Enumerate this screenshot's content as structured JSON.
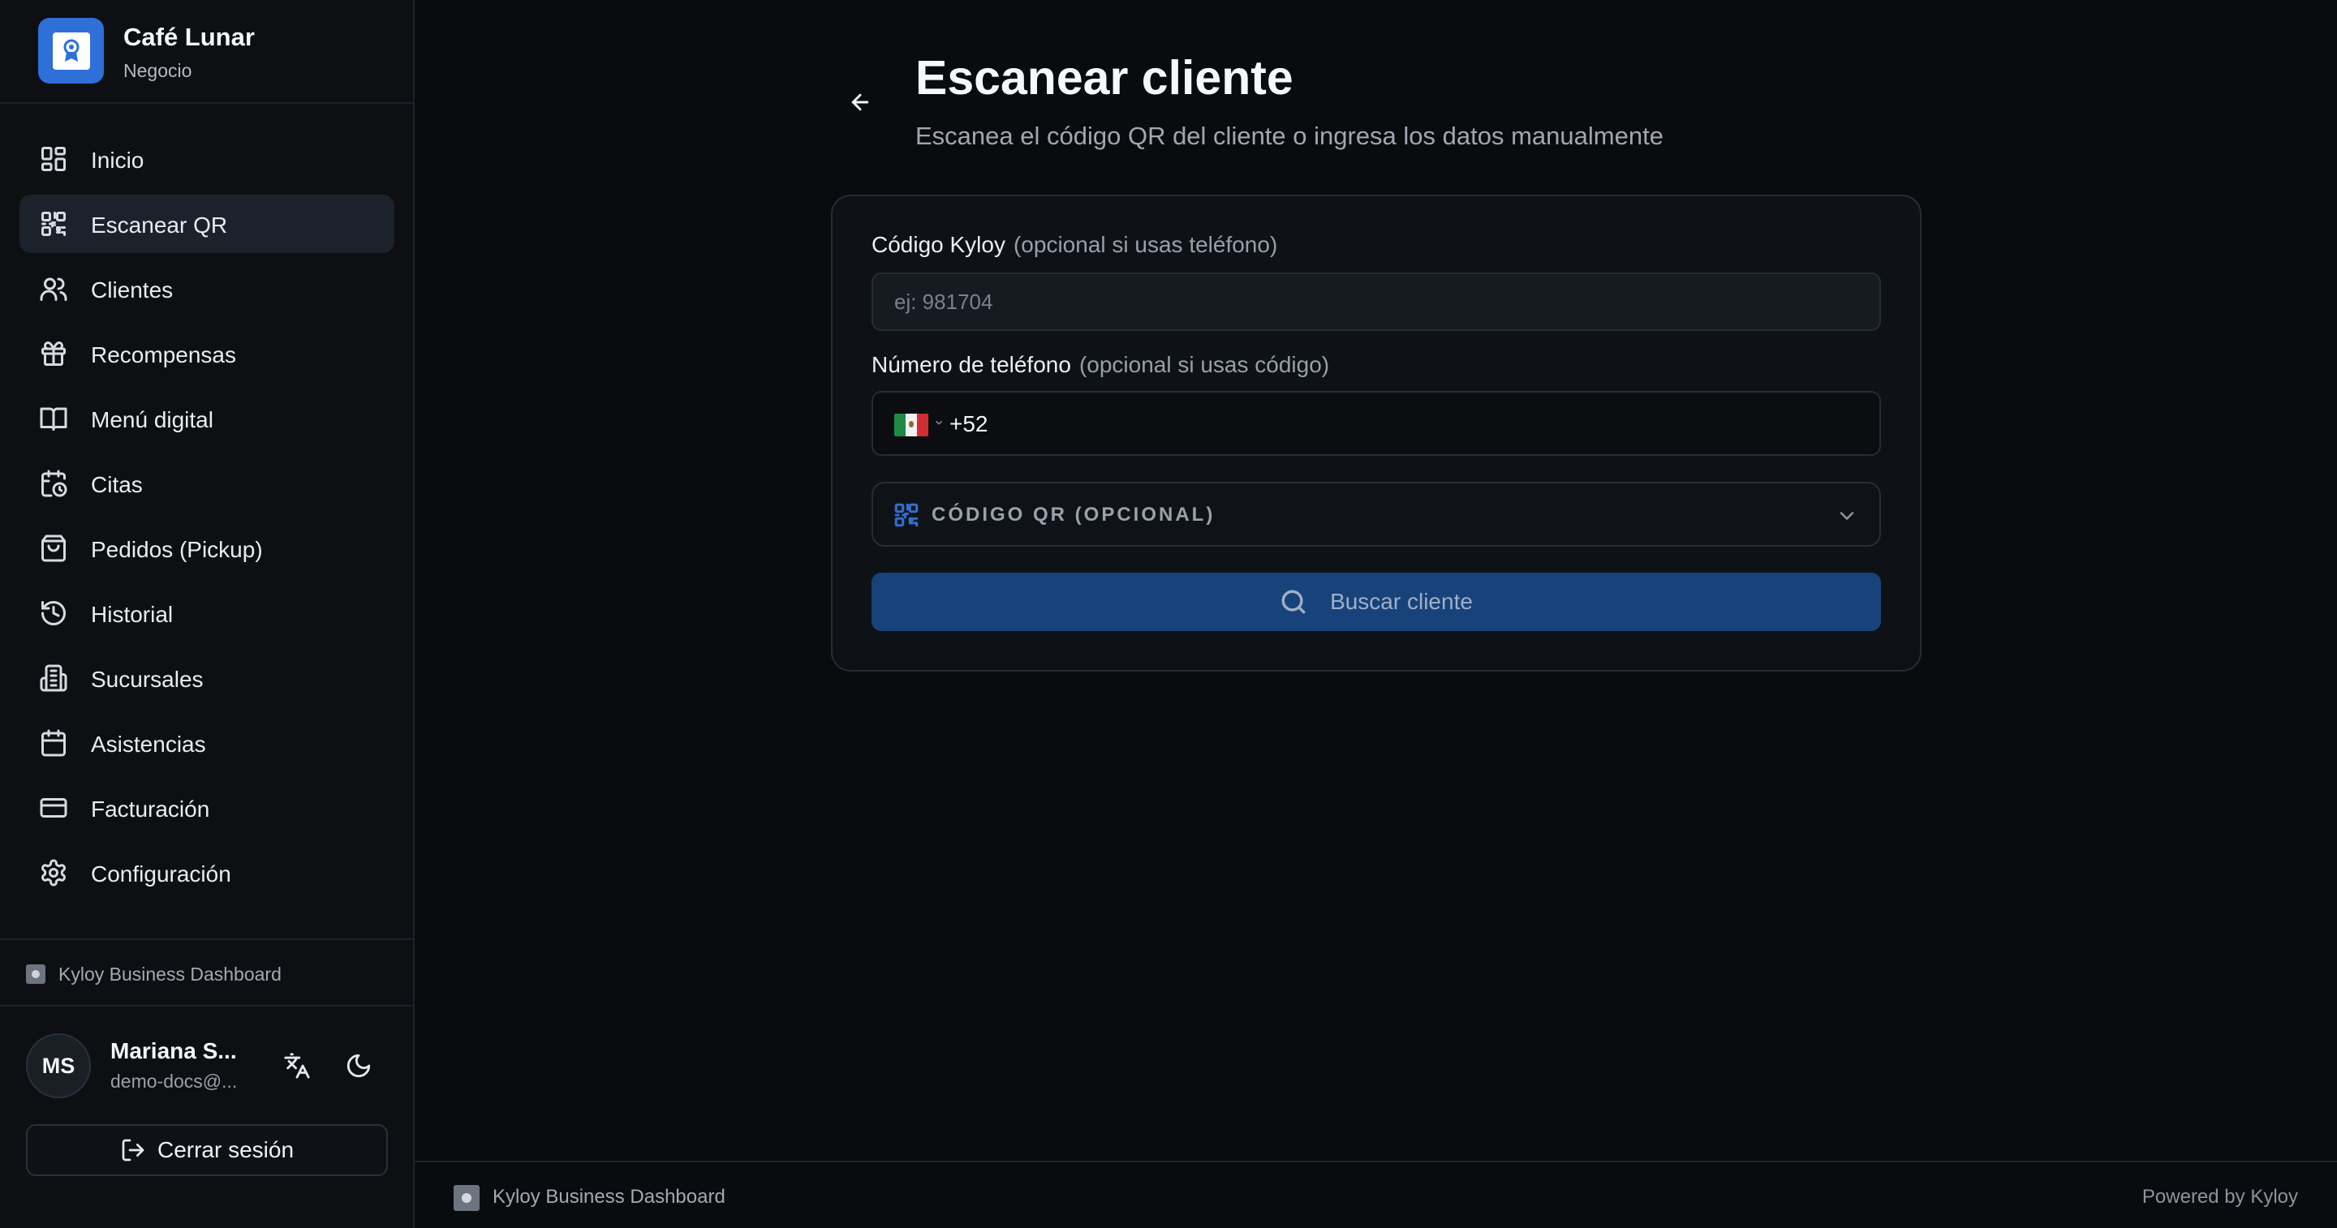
{
  "brand": {
    "name": "Café Lunar",
    "subtitle": "Negocio"
  },
  "sidebar": {
    "items": [
      {
        "label": "Inicio",
        "icon": "dashboard-icon",
        "active": false
      },
      {
        "label": "Escanear QR",
        "icon": "qr-code-icon",
        "active": true
      },
      {
        "label": "Clientes",
        "icon": "users-icon",
        "active": false
      },
      {
        "label": "Recompensas",
        "icon": "gift-icon",
        "active": false
      },
      {
        "label": "Menú digital",
        "icon": "book-icon",
        "active": false
      },
      {
        "label": "Citas",
        "icon": "calendar-clock-icon",
        "active": false
      },
      {
        "label": "Pedidos (Pickup)",
        "icon": "shopping-bag-icon",
        "active": false
      },
      {
        "label": "Historial",
        "icon": "history-icon",
        "active": false
      },
      {
        "label": "Sucursales",
        "icon": "building-icon",
        "active": false
      },
      {
        "label": "Asistencias",
        "icon": "calendar-icon",
        "active": false
      },
      {
        "label": "Facturación",
        "icon": "credit-card-icon",
        "active": false
      },
      {
        "label": "Configuración",
        "icon": "gear-icon",
        "active": false
      }
    ],
    "footer_tag": "Kyloy Business Dashboard"
  },
  "user": {
    "initials": "MS",
    "name": "Mariana S...",
    "email": "demo-docs@...",
    "logout_label": "Cerrar sesión"
  },
  "page": {
    "title": "Escanear cliente",
    "subtitle": "Escanea el código QR del cliente o ingresa los datos manualmente"
  },
  "form": {
    "code_label": "Código Kyloy",
    "code_hint": "(opcional si usas teléfono)",
    "code_placeholder": "ej: 981704",
    "code_value": "",
    "phone_label": "Número de teléfono",
    "phone_hint": "(opcional si usas código)",
    "phone_country": "MX",
    "phone_code": "+52",
    "qr_toggle_label": "CÓDIGO QR (OPCIONAL)",
    "search_label": "Buscar cliente"
  },
  "footer": {
    "left": "Kyloy Business Dashboard",
    "right": "Powered by Kyloy"
  },
  "colors": {
    "background": "#0a0b0e",
    "sidebar": "#0d0f13",
    "accent": "#2e6fd8",
    "button": "#17427a",
    "active_nav": "#1c222b"
  }
}
